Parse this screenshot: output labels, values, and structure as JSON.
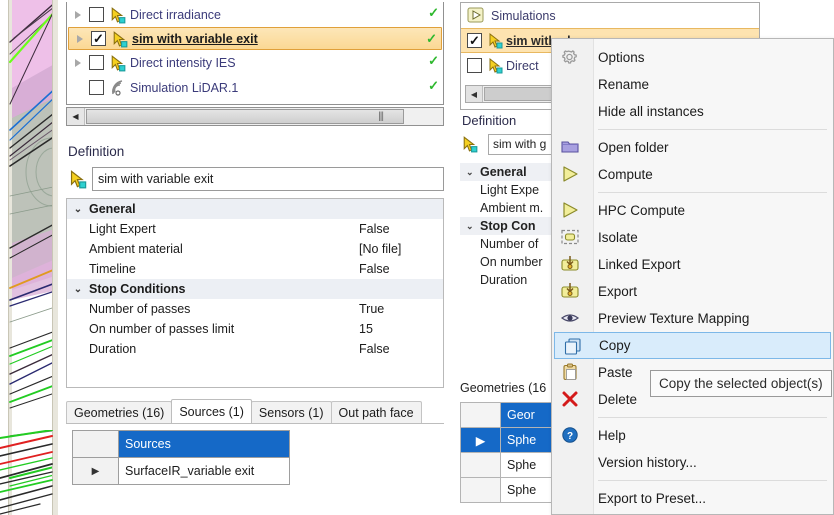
{
  "viewport": {
    "name": "cad-3d-viewport",
    "description": "3D ray-trace viewport showing optical simulation rays",
    "region_colors": {
      "upper_fill": "#eec0e8",
      "lower_fill": "#b9c4b4",
      "background": "#ffffff"
    },
    "ray_colors": [
      "#2b2b2b",
      "#22cc22",
      "#1a6fd4",
      "#e02020",
      "#2a2a70",
      "#e09a20",
      "#7a4a7a"
    ]
  },
  "tree": {
    "scroll_left_arrow": "◀",
    "scroll_grip": "|||",
    "items": [
      {
        "label": "Direct irradiance",
        "checked": false,
        "twisty": true,
        "icon": "simulation-cursor-icon",
        "status": "✓"
      },
      {
        "label": "sim with variable exit",
        "checked": true,
        "twisty": true,
        "icon": "simulation-cursor-icon",
        "status": "✓",
        "selected": true
      },
      {
        "label": "Direct intensity IES",
        "checked": false,
        "twisty": true,
        "icon": "simulation-cursor-icon",
        "status": "✓"
      },
      {
        "label": "Simulation LiDAR.1",
        "checked": false,
        "twisty": false,
        "icon": "lidar-wave-icon",
        "status": "✓"
      }
    ]
  },
  "definition": {
    "title": "Definition",
    "name_icon": "simulation-cursor-icon",
    "name_value": "sim with variable exit",
    "properties": [
      {
        "type": "group",
        "name": "General",
        "value": "",
        "chevron": "⌄"
      },
      {
        "type": "item",
        "name": "Light Expert",
        "value": "False"
      },
      {
        "type": "item",
        "name": "Ambient material",
        "value": "[No file]"
      },
      {
        "type": "item",
        "name": "Timeline",
        "value": "False"
      },
      {
        "type": "group",
        "name": "Stop Conditions",
        "value": "",
        "chevron": "⌄"
      },
      {
        "type": "item",
        "name": "Number of passes",
        "value": "True"
      },
      {
        "type": "item",
        "name": "On number of passes limit",
        "value": "15"
      },
      {
        "type": "item",
        "name": "Duration",
        "value": "False"
      }
    ]
  },
  "tabs": [
    {
      "label": "Geometries (16)",
      "active": false
    },
    {
      "label": "Sources (1)",
      "active": true
    },
    {
      "label": "Sensors (1)",
      "active": false
    },
    {
      "label": "Out path face",
      "active": false
    }
  ],
  "sources_table": {
    "header": {
      "gutter": "",
      "column": "Sources"
    },
    "rows": [
      {
        "gutter": "▶",
        "value": "SurfaceIR_variable exit"
      }
    ]
  },
  "background_panel": {
    "tree": {
      "items": [
        {
          "label": "Simulations",
          "icon": "folder-play-icon",
          "kind": "root"
        },
        {
          "label": "sim with glass",
          "icon": "simulation-cursor-icon",
          "checked": true,
          "selected": true
        },
        {
          "label": "Direct",
          "icon": "simulation-cursor-icon",
          "checked": false
        }
      ],
      "scroll_left_arrow": "◀"
    },
    "definition_title": "Definition",
    "name_value": "sim with g",
    "properties": [
      {
        "type": "group",
        "name": "General",
        "chevron": "⌄"
      },
      {
        "type": "item",
        "name": "Light Expe"
      },
      {
        "type": "item",
        "name": "Ambient m."
      },
      {
        "type": "group",
        "name": "Stop Con",
        "chevron": "⌄"
      },
      {
        "type": "item",
        "name": "Number of"
      },
      {
        "type": "item",
        "name": "On number"
      },
      {
        "type": "item",
        "name": "Duration"
      }
    ],
    "geometries_title": "Geometries (16",
    "geometries_table": {
      "header": {
        "gutter": "",
        "column": "Geor"
      },
      "rows": [
        {
          "gutter": "▶",
          "value": "Sphe",
          "selected": true
        },
        {
          "gutter": "",
          "value": "Sphe",
          "selected": false
        },
        {
          "gutter": "",
          "value": "Sphe",
          "selected": false
        }
      ]
    }
  },
  "context_menu": {
    "items": [
      {
        "label": "Options",
        "icon": "gear-icon",
        "type": "item"
      },
      {
        "label": "Rename",
        "icon": "",
        "type": "item"
      },
      {
        "label": "Hide all instances",
        "icon": "",
        "type": "item"
      },
      {
        "type": "separator"
      },
      {
        "label": "Open folder",
        "icon": "folder-icon",
        "type": "item"
      },
      {
        "label": "Compute",
        "icon": "play-icon",
        "type": "item"
      },
      {
        "type": "separator"
      },
      {
        "label": "HPC Compute",
        "icon": "play-icon",
        "type": "item"
      },
      {
        "label": "Isolate",
        "icon": "isolate-icon",
        "type": "item"
      },
      {
        "label": "Linked Export",
        "icon": "linked-export-icon",
        "type": "item"
      },
      {
        "label": "Export",
        "icon": "export-icon",
        "type": "item"
      },
      {
        "label": "Preview Texture Mapping",
        "icon": "eye-icon",
        "type": "item"
      },
      {
        "label": "Copy",
        "icon": "copy-icon",
        "type": "item",
        "highlighted": true
      },
      {
        "label": "Paste",
        "icon": "paste-icon",
        "type": "item"
      },
      {
        "label": "Delete",
        "icon": "delete-x-icon",
        "type": "item"
      },
      {
        "type": "separator"
      },
      {
        "label": "Help",
        "icon": "help-icon",
        "type": "item"
      },
      {
        "label": "Version history...",
        "icon": "",
        "type": "item"
      },
      {
        "type": "separator"
      },
      {
        "label": "Export to Preset...",
        "icon": "",
        "type": "item"
      }
    ],
    "highlight_color": "#d9ecfb"
  },
  "tooltip": {
    "text": "Copy the selected object(s)"
  }
}
